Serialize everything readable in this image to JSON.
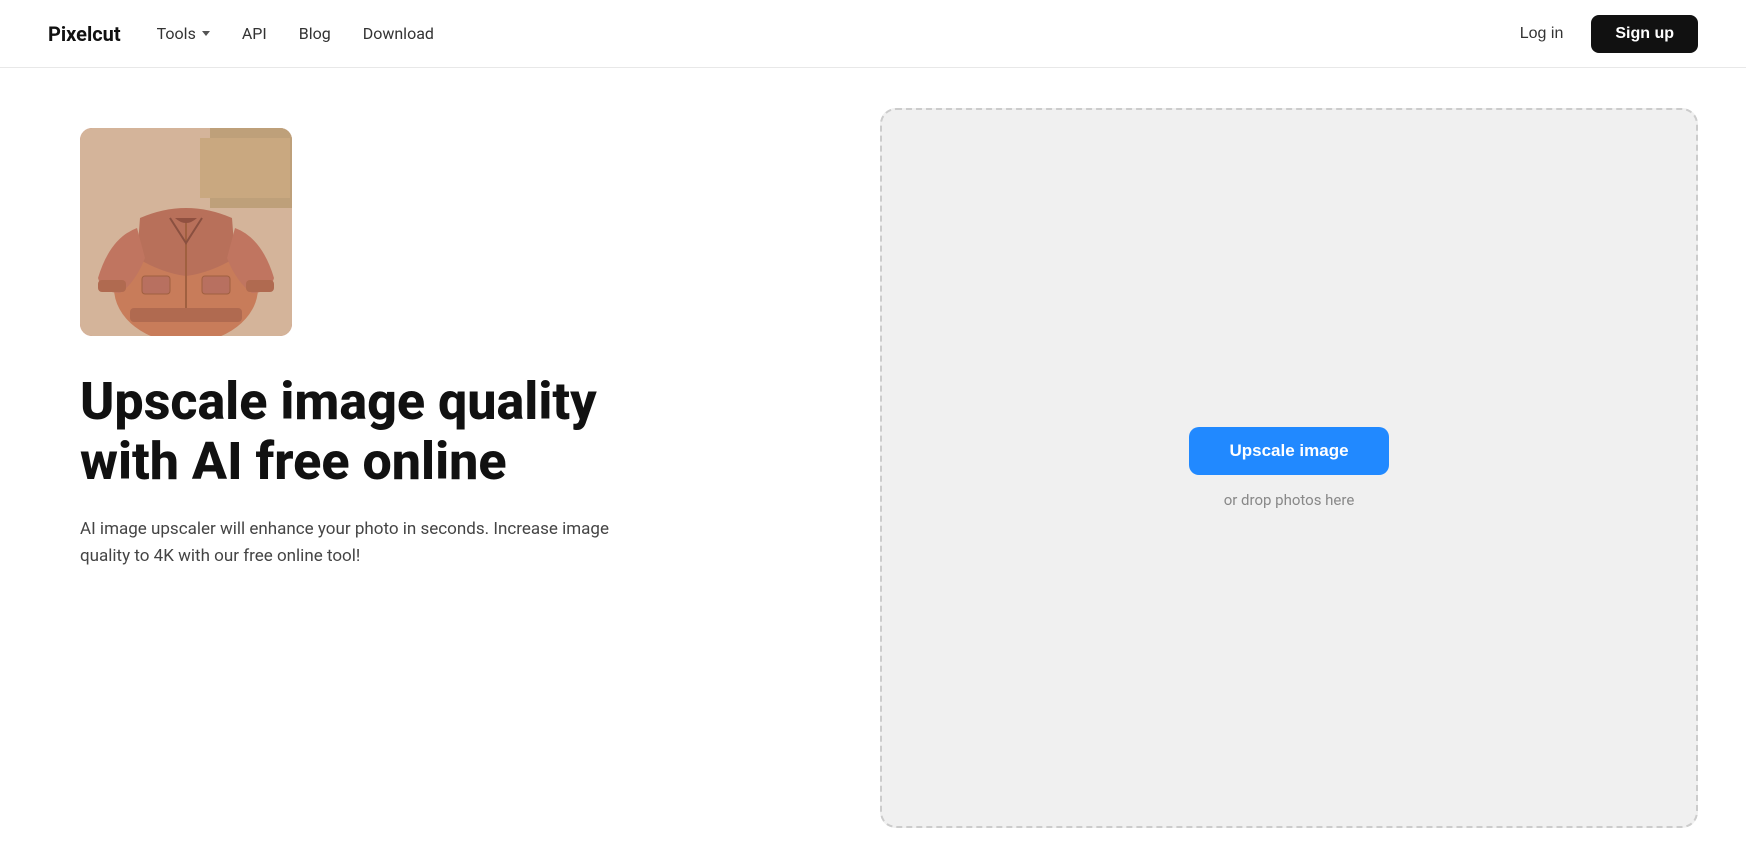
{
  "navbar": {
    "logo": "Pixelcut",
    "links": [
      {
        "label": "Tools",
        "hasDropdown": true
      },
      {
        "label": "API",
        "hasDropdown": false
      },
      {
        "label": "Blog",
        "hasDropdown": false
      },
      {
        "label": "Download",
        "hasDropdown": false
      }
    ],
    "login_label": "Log in",
    "signup_label": "Sign up"
  },
  "hero": {
    "title_line1": "Upscale image quality",
    "title_line2": "with AI free online",
    "description": "AI image upscaler will enhance your photo in seconds. Increase image quality to 4K with our free online tool!"
  },
  "upload_area": {
    "button_label": "Upscale image",
    "drop_hint": "or drop photos here"
  }
}
